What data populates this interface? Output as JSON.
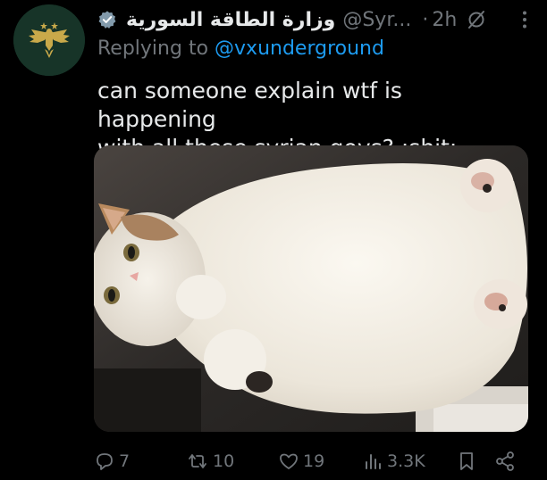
{
  "account": {
    "display_name": "وزارة الطاقة السورية",
    "handle": "@Syr...",
    "separator": "·",
    "time": "2h",
    "avatar_icon": "eagle-emblem-icon",
    "verified_icon": "verified-badge-icon"
  },
  "reply": {
    "prefix": "Replying to ",
    "mention": "@vxunderground"
  },
  "tweet": {
    "text_line1": "can someone explain wtf is happening",
    "text_line2": "with all these syrian govs? :shit:"
  },
  "media": {
    "subject": "cat-photo"
  },
  "actions": {
    "replies": "7",
    "reposts": "10",
    "likes": "19",
    "views": "3.3K"
  },
  "colors": {
    "background": "#000000",
    "text": "#e7e9ea",
    "secondary": "#71767b",
    "link": "#1d9bf0",
    "avatar_bg": "#173428"
  }
}
